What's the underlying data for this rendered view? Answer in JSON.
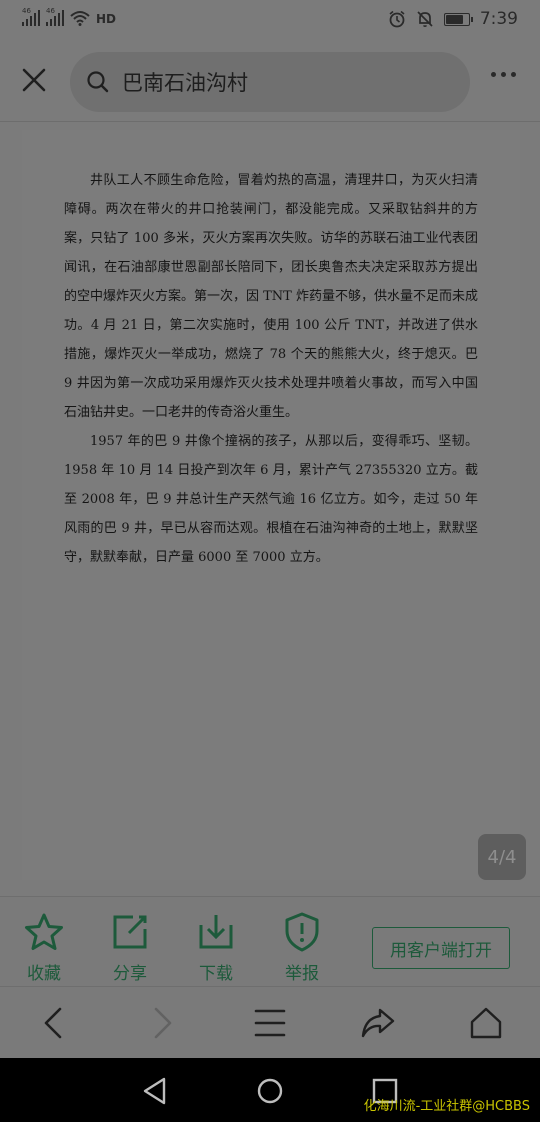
{
  "status_bar": {
    "signal1_label": "46",
    "signal2_label": "46",
    "signal_extra": "R",
    "hd_label": "HD",
    "time": "7:39",
    "battery_level": 0.8
  },
  "topnav": {
    "search_text": "巴南石油沟村"
  },
  "document": {
    "paragraphs": [
      "井队工人不顾生命危险，冒着灼热的高温，清理井口，为灭火扫清障碍。两次在带火的井口抢装闸门，都没能完成。又采取钻斜井的方案，只钻了 100 多米，灭火方案再次失败。访华的苏联石油工业代表团闻讯，在石油部康世恩副部长陪同下，团长奥鲁杰夫决定采取苏方提出的空中爆炸灭火方案。第一次，因 TNT 炸药量不够，供水量不足而未成功。4 月 21 日，第二次实施时，使用 100 公斤 TNT，并改进了供水措施，爆炸灭火一举成功，燃烧了 78 个天的熊熊大火，终于熄灭。巴 9 井因为第一次成功采用爆炸灭火技术处理井喷着火事故，而写入中国石油钻井史。一口老井的传奇浴火重生。",
      "1957 年的巴 9 井像个撞祸的孩子，从那以后，变得乖巧、坚韧。1958 年 10 月 14 日投产到次年 6 月，累计产气 27355320 立方。截至 2008 年，巴 9 井总计生产天然气逾 16 亿立方。如今，走过 50 年风雨的巴 9 井，早已从容而达观。根植在石油沟神奇的土地上，默默坚守，默默奉献，日产量 6000 至 7000 立方。"
    ],
    "page_indicator": "4/4"
  },
  "action_bar": {
    "favorite_label": "收藏",
    "share_label": "分享",
    "download_label": "下载",
    "report_label": "举报",
    "open_app_label": "用客户端打开"
  },
  "watermark": "化海川流-工业社群@HCBBS",
  "colors": {
    "accent": "#1d5a3b",
    "dim_overlay_bg": "#7b7b7b",
    "watermark": "#c9c400"
  }
}
